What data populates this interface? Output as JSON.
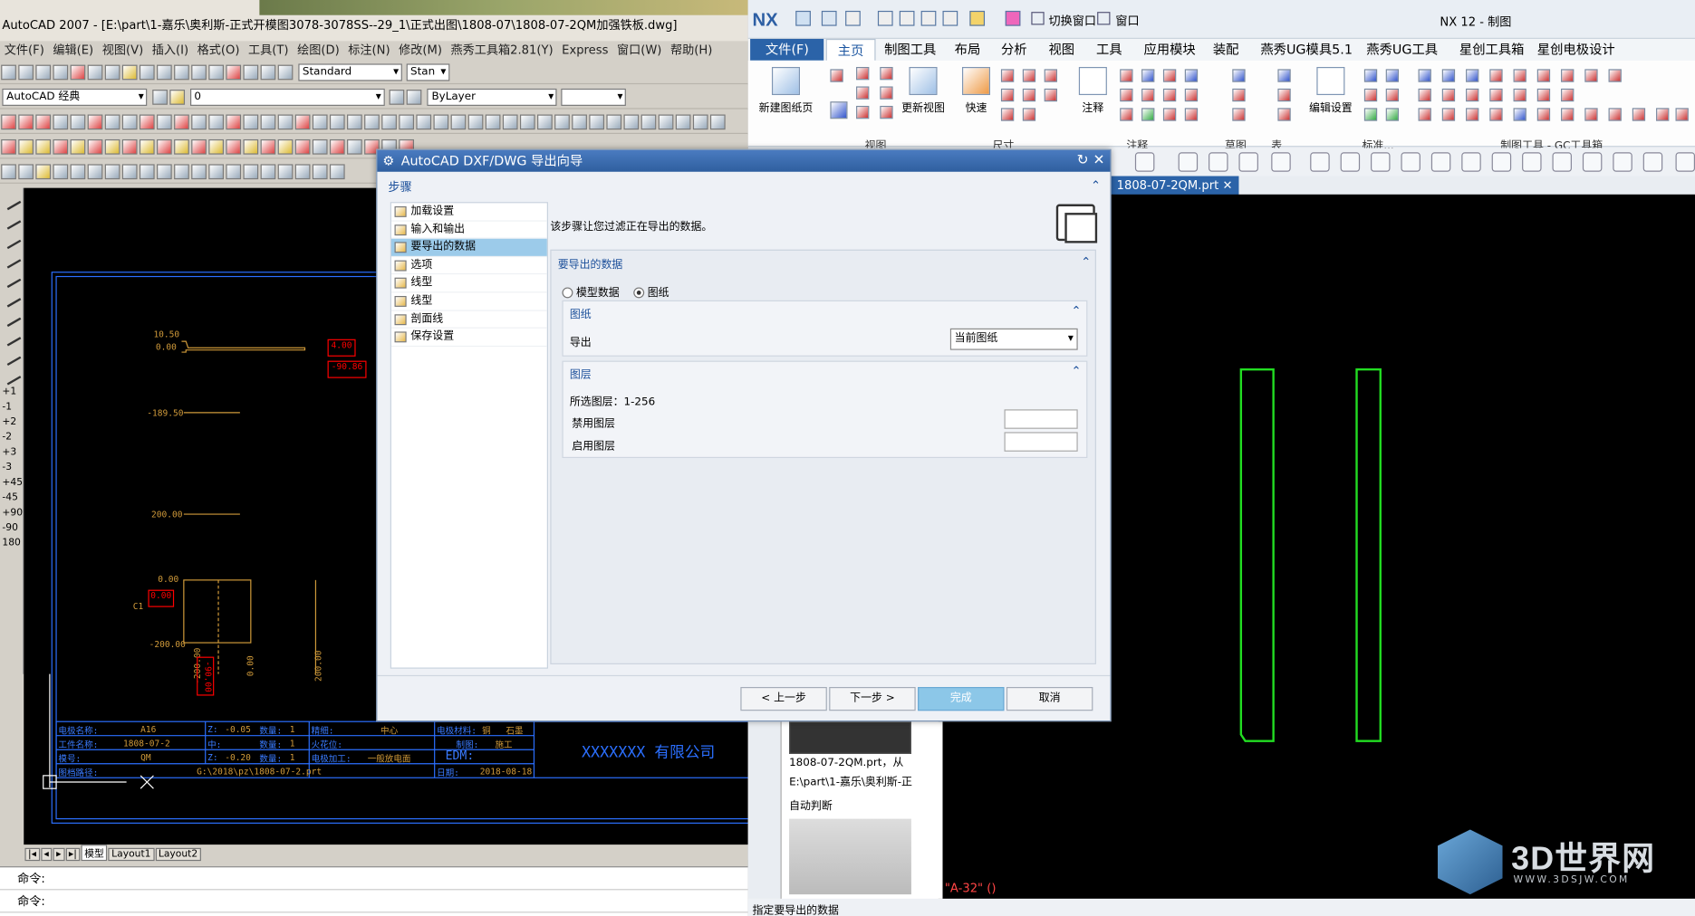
{
  "autocad": {
    "title": "AutoCAD 2007 - [E:\\part\\1-嘉乐\\奥利斯-正式开模图3078-3078SS--29_1\\正式出图\\1808-07\\1808-07-2QM加强铁板.dwg]",
    "menu": [
      "文件(F)",
      "编辑(E)",
      "视图(V)",
      "插入(I)",
      "格式(O)",
      "工具(T)",
      "绘图(D)",
      "标注(N)",
      "修改(M)",
      "燕秀工具箱2.81(Y)",
      "Express",
      "窗口(W)",
      "帮助(H)"
    ],
    "workspace": "AutoCAD 经典",
    "text_style": "Standard",
    "dim_style": "Stan",
    "layer": "0",
    "linetype": "ByLayer",
    "dims": [
      "10.50",
      "0.00",
      "-189.50",
      "200.00",
      "0.00",
      "-200.00",
      "-200.00",
      "0.00",
      "200.00"
    ],
    "c1_label": "C1",
    "red_labels": [
      "4.00",
      "-90.86",
      "0.00",
      "-90.00"
    ],
    "tb_fields": {
      "row1": [
        "电极名称:",
        "A16",
        "Z:",
        "-0.05",
        "数量:",
        "1",
        "精细:",
        "中心",
        "电极材料:",
        "铜",
        "石墨"
      ],
      "row2": [
        "工件名称:",
        "1808-07-2",
        "中:",
        "",
        "数量:",
        "1",
        "火花位:",
        "",
        "制图:",
        "施工"
      ],
      "row3": [
        "模号:",
        "QM",
        "Z:",
        "-0.20",
        "数量:",
        "1",
        "电极加工:",
        "一般放电面",
        "EDM:",
        ""
      ],
      "row4": [
        "图档路径:",
        "G:\\2018\\pz\\1808-07-2.prt",
        "",
        "",
        "",
        "",
        "日期:",
        "2018-08-18"
      ]
    },
    "company": "XXXXXXX 有限公司",
    "layout_tabs": [
      "模型",
      "Layout1",
      "Layout2"
    ],
    "cmd_lines": [
      "命令:",
      "命令:"
    ],
    "left_tools": [
      "+1",
      "-1",
      "+2",
      "-2",
      "+3",
      "-3",
      "+45",
      "-45",
      "+90",
      "-90",
      "180"
    ]
  },
  "nx": {
    "logo": "NX",
    "window_title": "NX 12 - 制图",
    "switch_window": "切换窗口",
    "window_menu": "窗口",
    "tabs": [
      "文件(F)",
      "主页",
      "制图工具",
      "布局",
      "分析",
      "视图",
      "工具",
      "应用模块",
      "装配",
      "燕秀UG模具5.1",
      "燕秀UG工具",
      "星创工具箱",
      "星创电极设计"
    ],
    "active_tab": "主页",
    "ribbon_buttons": {
      "new_sheet": "新建图纸页",
      "update_view": "更新视图",
      "quick": "快速",
      "note": "注释",
      "edit_settings": "编辑设置"
    },
    "ribbon_groups": [
      "视图",
      "尺寸",
      "注释",
      "草图",
      "表",
      "标准...",
      "制图工具 - GC工具箱"
    ],
    "doc_tab": "1808-07-2QM.prt",
    "nav_file": "1808-07-2QM.prt，从",
    "nav_path": "E:\\part\\1-嘉乐\\奥利斯-正",
    "auto_judge": "自动判断",
    "graphic_label": "\"A-32\"  ()",
    "status": "指定要导出的数据"
  },
  "dialog": {
    "title": "AutoCAD DXF/DWG 导出向导",
    "steps_label": "步骤",
    "steps": [
      "加载设置",
      "输入和输出",
      "要导出的数据",
      "选项",
      "线型",
      "线型",
      "剖面线",
      "保存设置"
    ],
    "selected_step": 2,
    "description": "该步骤让您过滤正在导出的数据。",
    "section_data": "要导出的数据",
    "radio_model": "模型数据",
    "radio_sheet": "图纸",
    "section_sheet": "图纸",
    "export_label": "导出",
    "export_value": "当前图纸",
    "section_layer": "图层",
    "selected_layers": "所选图层：1-256",
    "disabled_layers": "禁用图层",
    "enabled_layers": "启用图层",
    "buttons": {
      "back": "< 上一步",
      "next": "下一步 >",
      "finish": "完成",
      "cancel": "取消"
    }
  },
  "watermark": {
    "brand": "3D世界网",
    "url": "WWW.3DSJW.COM"
  }
}
